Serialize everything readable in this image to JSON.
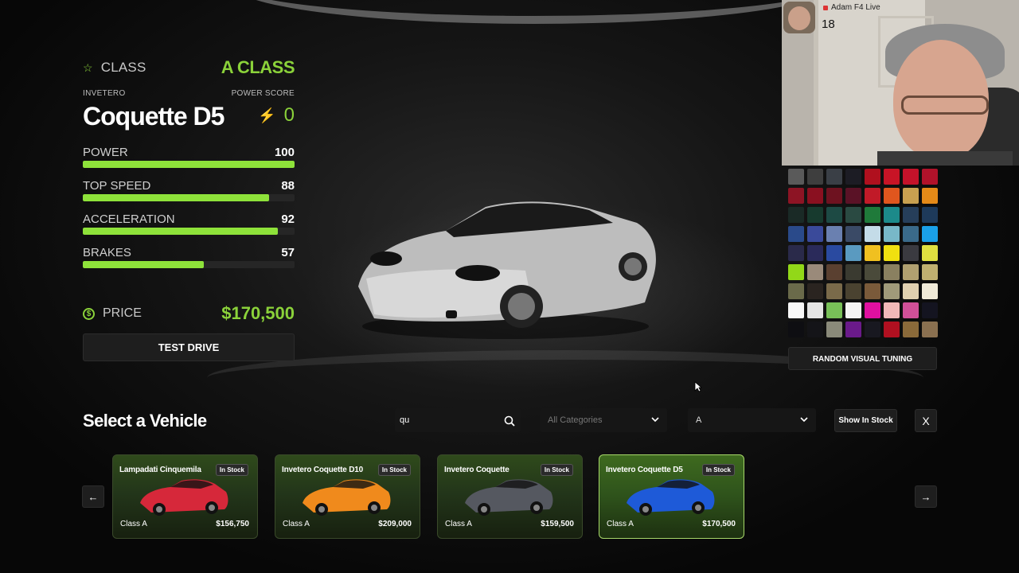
{
  "vehicle": {
    "class_label": "CLASS",
    "class_value": "A CLASS",
    "manufacturer": "INVETERO",
    "name": "Coquette D5",
    "power_score_label": "POWER SCORE",
    "power_score": "0",
    "stats": [
      {
        "label": "POWER",
        "value": "100",
        "fill_pct": 100
      },
      {
        "label": "TOP SPEED",
        "value": "88",
        "fill_pct": 88
      },
      {
        "label": "ACCELERATION",
        "value": "92",
        "fill_pct": 92
      },
      {
        "label": "BRAKES",
        "value": "57",
        "fill_pct": 57
      }
    ],
    "price_label": "PRICE",
    "price": "$170,500",
    "test_drive_label": "TEST DRIVE",
    "accent_color": "#8bd23a"
  },
  "stream": {
    "name": "Adam F4 Live",
    "viewers": "18"
  },
  "tuning": {
    "palette": [
      "#5a5a5a",
      "#3e3e3e",
      "#3a3f46",
      "#1c1c24",
      "#b0101e",
      "#c81426",
      "#c4122a",
      "#b1122a",
      "#8d1424",
      "#8a1020",
      "#6e1220",
      "#5a1226",
      "#c11a28",
      "#e0561e",
      "#c8a050",
      "#e58a18",
      "#1a2a26",
      "#173a2e",
      "#1d4a44",
      "#2a4a42",
      "#1f7a3a",
      "#1c8a8a",
      "#263e5a",
      "#1e3a5a",
      "#2a4a8a",
      "#3a4a9a",
      "#6a80b0",
      "#3a4a66",
      "#c4dce8",
      "#78b8c8",
      "#3a6a8a",
      "#1aa0e8",
      "#2a2a4a",
      "#2a2a5a",
      "#2a4aa0",
      "#5a9ac0",
      "#f0c020",
      "#f0e010",
      "#3a3a40",
      "#e0e040",
      "#92d818",
      "#9a8a7a",
      "#5a4030",
      "#3a3a30",
      "#4a4a3a",
      "#8a8060",
      "#b0a070",
      "#c0b070",
      "#6a6a4a",
      "#2a2420",
      "#7a6a4a",
      "#4a4230",
      "#7a5a3a",
      "#a09a7a",
      "#e0d0b0",
      "#f0ead8",
      "#f8f8f8",
      "#e4e4e4",
      "#78c058",
      "#f4f4f4",
      "#e010a0",
      "#f0b8b8",
      "#d05098",
      "#141420",
      "#0e0e12",
      "#141418",
      "#8a8a7a",
      "#6a1a8a",
      "#181820",
      "#b01020",
      "#8a6a3a",
      "#8a7050"
    ],
    "random_label": "RANDOM VISUAL TUNING"
  },
  "selection": {
    "title": "Select a Vehicle",
    "search_value": "qu",
    "category_placeholder": "All Categories",
    "class_filter": "A",
    "show_in_stock_label": "Show In Stock",
    "close_label": "X",
    "prev_label": "←",
    "next_label": "→",
    "cards": [
      {
        "name": "Lampadati Cinquemila",
        "stock": "In Stock",
        "class": "Class A",
        "price": "$156,750",
        "color": "#d6283a",
        "active": false
      },
      {
        "name": "Invetero Coquette D10",
        "stock": "In Stock",
        "class": "Class A",
        "price": "$209,000",
        "color": "#f08a1c",
        "active": false
      },
      {
        "name": "Invetero Coquette",
        "stock": "In Stock",
        "class": "Class A",
        "price": "$159,500",
        "color": "#555860",
        "active": false
      },
      {
        "name": "Invetero Coquette D5",
        "stock": "In Stock",
        "class": "Class A",
        "price": "$170,500",
        "color": "#1e5ad8",
        "active": true
      }
    ]
  }
}
